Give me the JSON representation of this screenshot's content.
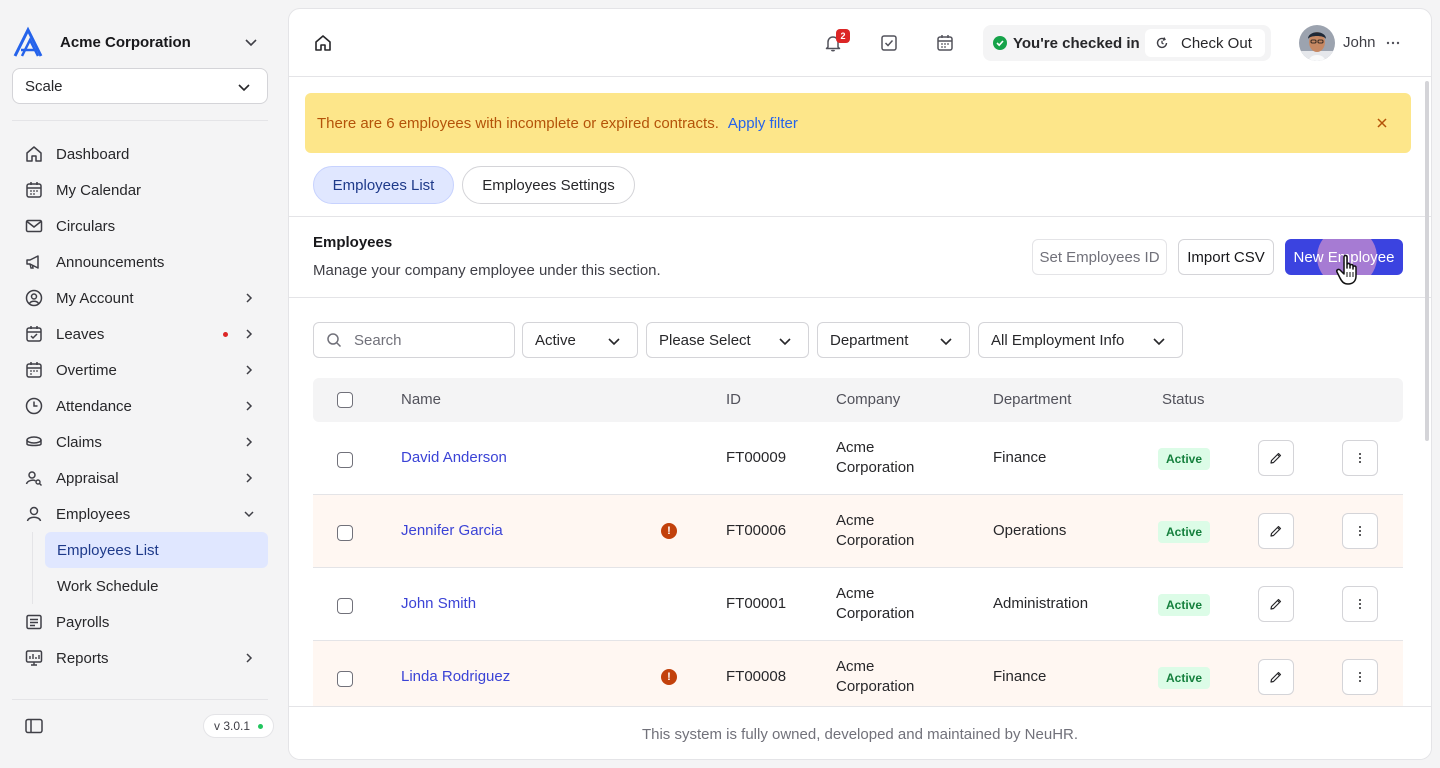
{
  "org": {
    "name": "Acme Corporation"
  },
  "scale_select": {
    "value": "Scale"
  },
  "nav": {
    "items": [
      {
        "label": "Dashboard"
      },
      {
        "label": "My Calendar"
      },
      {
        "label": "Circulars"
      },
      {
        "label": "Announcements"
      },
      {
        "label": "My Account"
      },
      {
        "label": "Leaves"
      },
      {
        "label": "Overtime"
      },
      {
        "label": "Attendance"
      },
      {
        "label": "Claims"
      },
      {
        "label": "Appraisal"
      },
      {
        "label": "Employees"
      }
    ],
    "sub_items": [
      {
        "label": "Employees List"
      },
      {
        "label": "Work Schedule"
      }
    ],
    "after": [
      {
        "label": "Payrolls"
      },
      {
        "label": "Reports"
      }
    ]
  },
  "version": "v 3.0.1",
  "topbar": {
    "notification_count": "2",
    "checkin_status": "You're checked in",
    "checkout_label": "Check Out",
    "user_name": "John"
  },
  "alert": {
    "text": "There are 6 employees with incomplete or expired contracts.",
    "link": "Apply filter"
  },
  "tabs": [
    {
      "label": "Employees List"
    },
    {
      "label": "Employees Settings"
    }
  ],
  "section": {
    "title": "Employees",
    "subtitle": "Manage your company employee under this section."
  },
  "actions": {
    "set_id": "Set Employees ID",
    "import": "Import CSV",
    "new": "New Employee"
  },
  "filters": {
    "search_placeholder": "Search",
    "status": "Active",
    "select": "Please Select",
    "department": "Department",
    "employment": "All Employment Info"
  },
  "table": {
    "headers": {
      "name": "Name",
      "id": "ID",
      "company": "Company",
      "department": "Department",
      "status": "Status"
    },
    "rows": [
      {
        "name": "David Anderson",
        "id": "FT00009",
        "company_line1": "Acme",
        "company_line2": "Corporation",
        "department": "Finance",
        "status": "Active"
      },
      {
        "name": "Jennifer Garcia",
        "id": "FT00006",
        "company_line1": "Acme",
        "company_line2": "Corporation",
        "department": "Operations",
        "status": "Active"
      },
      {
        "name": "John Smith",
        "id": "FT00001",
        "company_line1": "Acme",
        "company_line2": "Corporation",
        "department": "Administration",
        "status": "Active"
      },
      {
        "name": "Linda Rodriguez",
        "id": "FT00008",
        "company_line1": "Acme",
        "company_line2": "Corporation",
        "department": "Finance",
        "status": "Active"
      }
    ]
  },
  "footer": "This system is fully owned, developed and maintained by NeuHR."
}
